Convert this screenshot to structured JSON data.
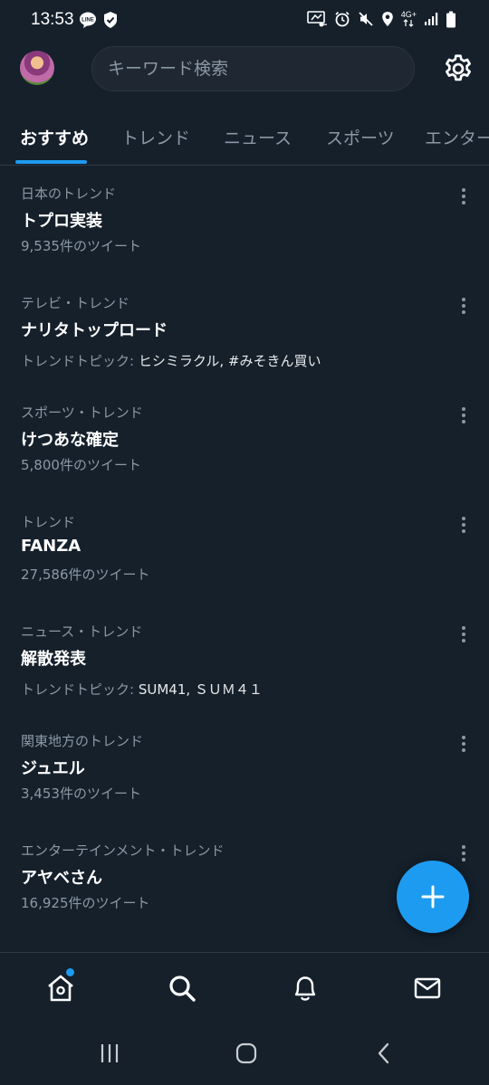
{
  "status_bar": {
    "time": "13:53",
    "network": "4G+",
    "left_icons": [
      "line-icon",
      "shield-check-icon"
    ],
    "right_icons": [
      "nfc-icon",
      "alarm-icon",
      "mute-icon",
      "location-icon",
      "signal-icon",
      "battery-icon"
    ]
  },
  "header": {
    "search_placeholder": "キーワード検索"
  },
  "tabs": [
    {
      "label": "おすすめ",
      "active": true
    },
    {
      "label": "トレンド",
      "active": false
    },
    {
      "label": "ニュース",
      "active": false
    },
    {
      "label": "スポーツ",
      "active": false
    },
    {
      "label": "エンター",
      "active": false
    }
  ],
  "trends": [
    {
      "context": "日本のトレンド",
      "name": "トプロ実装",
      "meta": "9,535件のツイート"
    },
    {
      "context": "テレビ・トレンド",
      "name": "ナリタトップロード",
      "meta_prefix": "トレンドトピック: ",
      "meta_topics": "ヒシミラクル, #みそきん買い"
    },
    {
      "context": "スポーツ・トレンド",
      "name": "けつあな確定",
      "meta": "5,800件のツイート"
    },
    {
      "context": "トレンド",
      "name": "FANZA",
      "meta": "27,586件のツイート"
    },
    {
      "context": "ニュース・トレンド",
      "name": "解散発表",
      "meta_prefix": "トレンドトピック: ",
      "meta_topics": "SUM41, ＳＵＭ４１"
    },
    {
      "context": "関東地方のトレンド",
      "name": "ジュエル",
      "meta": "3,453件のツイート"
    },
    {
      "context": "エンターテインメント・トレンド",
      "name": "アヤベさん",
      "meta": "16,925件のツイート"
    }
  ],
  "colors": {
    "background": "#15202b",
    "accent": "#1d9bf0",
    "secondary_text": "#8b98a5",
    "primary_text": "#ffffff"
  },
  "fab": {
    "icon": "plus-icon"
  },
  "bottom_nav": {
    "items": [
      "home-icon",
      "search-icon",
      "bell-icon",
      "mail-icon"
    ],
    "home_has_notification": true
  },
  "system_nav": [
    "recents-icon",
    "home-circle-icon",
    "back-icon"
  ]
}
